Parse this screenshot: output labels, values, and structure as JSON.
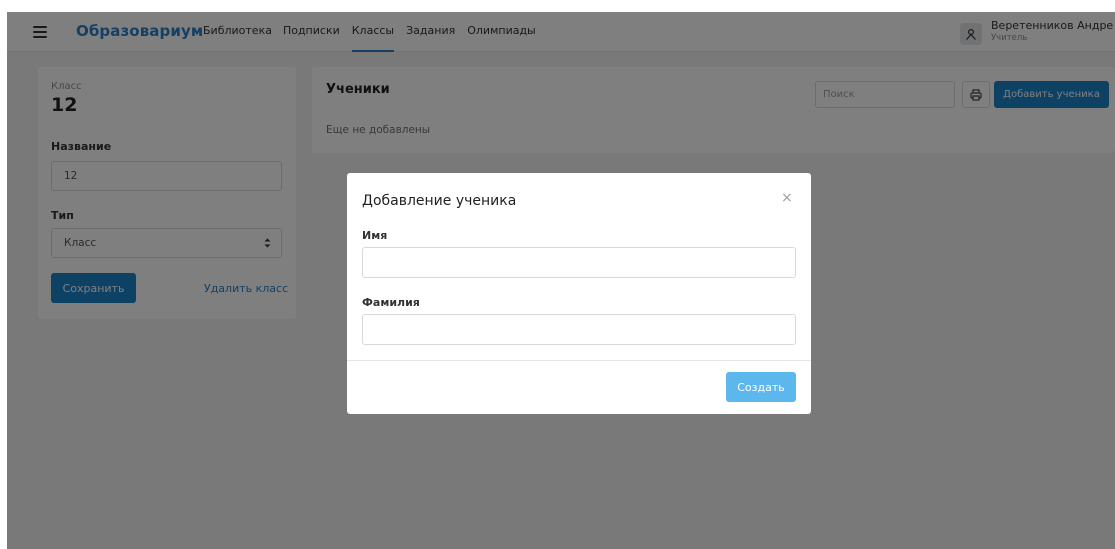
{
  "header": {
    "menu_icon": "hamburger-icon",
    "brand": "Образовариум",
    "nav": [
      {
        "label": "Библиотека",
        "active": false
      },
      {
        "label": "Подписки",
        "active": false
      },
      {
        "label": "Классы",
        "active": true
      },
      {
        "label": "Задания",
        "active": false
      },
      {
        "label": "Олимпиады",
        "active": false
      }
    ],
    "user": {
      "avatar_icon": "user-icon",
      "name": "Веретенников Андре",
      "role": "Учитель"
    }
  },
  "class_card": {
    "class_label": "Класс",
    "class_number": "12",
    "name_label": "Название",
    "name_value": "12",
    "type_label": "Тип",
    "type_value": "Класс",
    "save_label": "Сохранить",
    "delete_label": "Удалить класс"
  },
  "students": {
    "title": "Ученики",
    "empty_text": "Еще не добавлены",
    "search_placeholder": "Поиск",
    "print_icon": "print-icon",
    "add_label": "Добавить ученика"
  },
  "modal": {
    "title": "Добавление ученика",
    "close_glyph": "×",
    "first_name_label": "Имя",
    "first_name_value": "",
    "last_name_label": "Фамилия",
    "last_name_value": "",
    "create_label": "Создать"
  },
  "colors": {
    "brand": "#2a7fc6",
    "primary_button": "#1a84c9",
    "create_button_disabled": "#5bb7ec",
    "backdrop": "rgba(0,0,0,0.5)"
  }
}
